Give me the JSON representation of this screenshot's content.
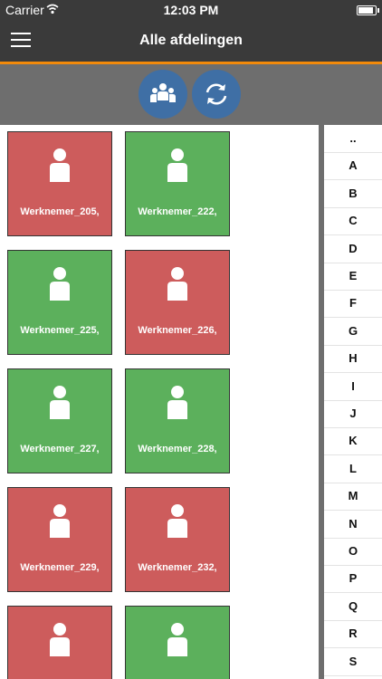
{
  "status_bar": {
    "carrier": "Carrier",
    "time": "12:03 PM",
    "battery_level": 0.9
  },
  "nav": {
    "title": "Alle afdelingen",
    "menu_icon": "menu-icon"
  },
  "toolbar": {
    "buttons": [
      {
        "name": "group-button",
        "icon": "group-icon"
      },
      {
        "name": "refresh-button",
        "icon": "refresh-icon"
      }
    ]
  },
  "colors": {
    "red": "#cd5c5c",
    "green": "#5cb05c",
    "accent": "#f28a0b",
    "button": "#3f6fa5"
  },
  "employees": [
    {
      "label": "Werknemer_205,",
      "status": "red"
    },
    {
      "label": "Werknemer_222,",
      "status": "green"
    },
    {
      "label": "Werknemer_225,",
      "status": "green"
    },
    {
      "label": "Werknemer_226,",
      "status": "red"
    },
    {
      "label": "Werknemer_227,",
      "status": "green"
    },
    {
      "label": "Werknemer_228,",
      "status": "green"
    },
    {
      "label": "Werknemer_229,",
      "status": "red"
    },
    {
      "label": "Werknemer_232,",
      "status": "red"
    },
    {
      "label": "",
      "status": "red"
    },
    {
      "label": "",
      "status": "green"
    }
  ],
  "index": [
    "..",
    "A",
    "B",
    "C",
    "D",
    "E",
    "F",
    "G",
    "H",
    "I",
    "J",
    "K",
    "L",
    "M",
    "N",
    "O",
    "P",
    "Q",
    "R",
    "S"
  ]
}
